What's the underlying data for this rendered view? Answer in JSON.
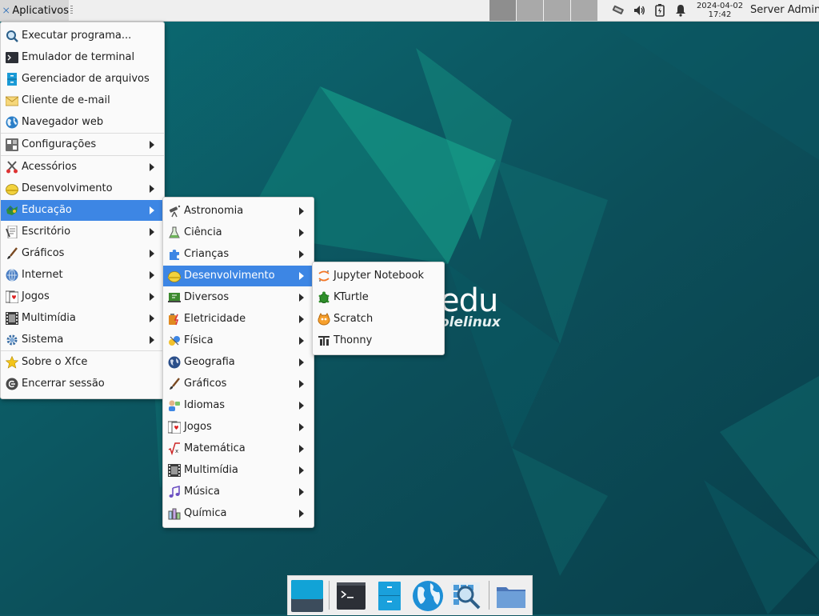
{
  "panel": {
    "apps_label": "Aplicativos",
    "clock_date": "2024-04-02",
    "clock_time": "17:42",
    "user_name": "Server Admin",
    "workspaces": [
      "1",
      "2",
      "3",
      "4"
    ]
  },
  "wallpaper": {
    "brand_big": "edu",
    "brand_small": "olelinux"
  },
  "main_menu": {
    "items": [
      {
        "label": "Executar programa...",
        "icon": "run-icon"
      },
      {
        "label": "Emulador de terminal",
        "icon": "terminal-icon"
      },
      {
        "label": "Gerenciador de arquivos",
        "icon": "file-manager-icon"
      },
      {
        "label": "Cliente de e-mail",
        "icon": "mail-icon"
      },
      {
        "label": "Navegador web",
        "icon": "globe-icon"
      },
      {
        "label": "Configurações",
        "icon": "settings-icon"
      },
      {
        "label": "Acessórios",
        "icon": "accessories-icon"
      },
      {
        "label": "Desenvolvimento",
        "icon": "development-icon"
      },
      {
        "label": "Educação",
        "icon": "education-icon"
      },
      {
        "label": "Escritório",
        "icon": "office-icon"
      },
      {
        "label": "Gráficos",
        "icon": "graphics-icon"
      },
      {
        "label": "Internet",
        "icon": "internet-icon"
      },
      {
        "label": "Jogos",
        "icon": "games-icon"
      },
      {
        "label": "Multimídia",
        "icon": "multimedia-icon"
      },
      {
        "label": "Sistema",
        "icon": "system-icon"
      },
      {
        "label": "Sobre o Xfce",
        "icon": "star-icon"
      },
      {
        "label": "Encerrar sessão",
        "icon": "logout-icon"
      }
    ],
    "active": "Educação"
  },
  "education_menu": {
    "items": [
      {
        "label": "Astronomia",
        "icon": "astronomy-icon"
      },
      {
        "label": "Ciência",
        "icon": "science-icon"
      },
      {
        "label": "Crianças",
        "icon": "puzzle-icon"
      },
      {
        "label": "Desenvolvimento",
        "icon": "development-icon"
      },
      {
        "label": "Diversos",
        "icon": "misc-icon"
      },
      {
        "label": "Eletricidade",
        "icon": "electricity-icon"
      },
      {
        "label": "Física",
        "icon": "physics-icon"
      },
      {
        "label": "Geografia",
        "icon": "geography-icon"
      },
      {
        "label": "Gráficos",
        "icon": "graphics-icon"
      },
      {
        "label": "Idiomas",
        "icon": "languages-icon"
      },
      {
        "label": "Jogos",
        "icon": "games-icon"
      },
      {
        "label": "Matemática",
        "icon": "math-icon"
      },
      {
        "label": "Multimídia",
        "icon": "multimedia-icon"
      },
      {
        "label": "Música",
        "icon": "music-icon"
      },
      {
        "label": "Química",
        "icon": "chemistry-icon"
      }
    ],
    "active": "Desenvolvimento"
  },
  "dev_menu": {
    "items": [
      {
        "label": "Jupyter Notebook",
        "icon": "jupyter-icon"
      },
      {
        "label": "KTurtle",
        "icon": "turtle-icon"
      },
      {
        "label": "Scratch",
        "icon": "scratch-icon"
      },
      {
        "label": "Thonny",
        "icon": "thonny-icon"
      }
    ]
  },
  "dock": {
    "items": [
      "show-desktop-icon",
      "terminal-icon",
      "file-manager-icon",
      "web-browser-icon",
      "app-finder-icon",
      "folder-icon"
    ]
  },
  "colors": {
    "accent": "#3d86e4",
    "panel": "#efefef",
    "desktop": "#0d5560"
  }
}
